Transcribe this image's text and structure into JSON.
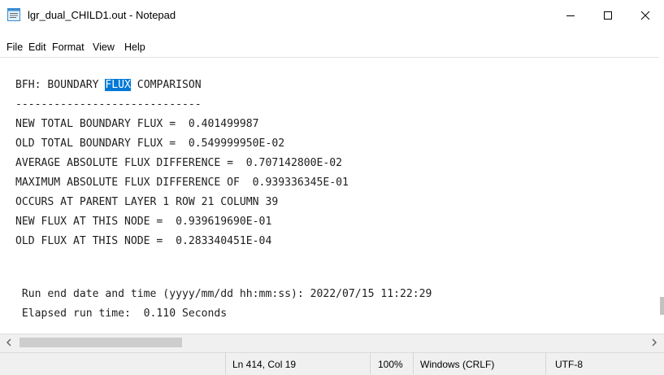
{
  "window": {
    "title": "lgr_dual_CHILD1.out - Notepad",
    "app_icon": "notepad-icon",
    "controls": [
      "minimize-icon",
      "maximize-icon",
      "close-icon"
    ]
  },
  "menu": {
    "items": [
      "File",
      "Edit",
      "Format",
      "View",
      "Help"
    ]
  },
  "editor": {
    "selection": {
      "line": 0,
      "text": "FLUX",
      "color": "#0078d7"
    },
    "lines": [
      "BFH: BOUNDARY FLUX COMPARISON",
      "-----------------------------",
      "NEW TOTAL BOUNDARY FLUX =  0.401499987",
      "OLD TOTAL BOUNDARY FLUX =  0.549999950E-02",
      "AVERAGE ABSOLUTE FLUX DIFFERENCE =  0.707142800E-02",
      "MAXIMUM ABSOLUTE FLUX DIFFERENCE OF  0.939336345E-01",
      "OCCURS AT PARENT LAYER 1 ROW 21 COLUMN 39",
      "NEW FLUX AT THIS NODE =  0.939619690E-01",
      "OLD FLUX AT THIS NODE =  0.283340451E-04",
      "",
      "",
      " Run end date and time (yyyy/mm/dd hh:mm:ss): 2022/07/15 11:22:29",
      " Elapsed run time:  0.110 Seconds"
    ]
  },
  "status": {
    "position": "Ln 414, Col 19",
    "zoom": "100%",
    "line_ending": "Windows (CRLF)",
    "encoding": "UTF-8"
  }
}
